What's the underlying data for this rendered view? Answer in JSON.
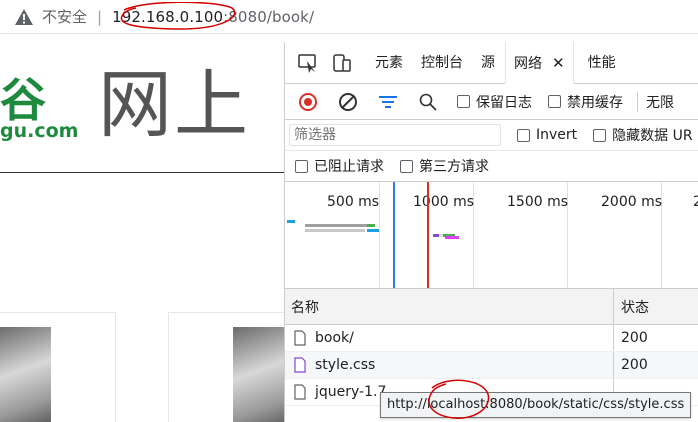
{
  "address_bar": {
    "security_label": "不安全",
    "separator": "|",
    "url_host": "192.168.0.100",
    "url_rest": ":8080/book/"
  },
  "page": {
    "logo_mark": "谷",
    "logo_domain": "gu.com",
    "title": "网上"
  },
  "devtools": {
    "tabs": [
      {
        "label": "元素"
      },
      {
        "label": "控制台"
      },
      {
        "label": "源"
      },
      {
        "label": "网络",
        "active": true
      },
      {
        "label": "性能"
      }
    ],
    "tab_close": "✕",
    "toolbar": {
      "preserve_log": "保留日志",
      "disable_cache": "禁用缓存",
      "throttle": "无限"
    },
    "filter": {
      "placeholder": "筛选器",
      "invert": "Invert",
      "hide_data_urls": "隐藏数据 UR"
    },
    "filter2": {
      "blocked": "已阻止请求",
      "third_party": "第三方请求"
    },
    "timeline_ticks": [
      "500 ms",
      "1000 ms",
      "1500 ms",
      "2000 ms",
      "2"
    ],
    "table": {
      "col_name": "名称",
      "col_status": "状态",
      "rows": [
        {
          "name": "book/",
          "status": "200"
        },
        {
          "name": "style.css",
          "status": "200"
        },
        {
          "name": "jquery-1.7",
          "status": ""
        },
        {
          "name": "",
          "status": ""
        }
      ]
    },
    "tooltip": "http://localhost:8080/book/static/css/style.css"
  },
  "colors": {
    "accent_green": "#1e8a3e",
    "record_red": "#d93025",
    "annotation_red": "#d40000"
  }
}
